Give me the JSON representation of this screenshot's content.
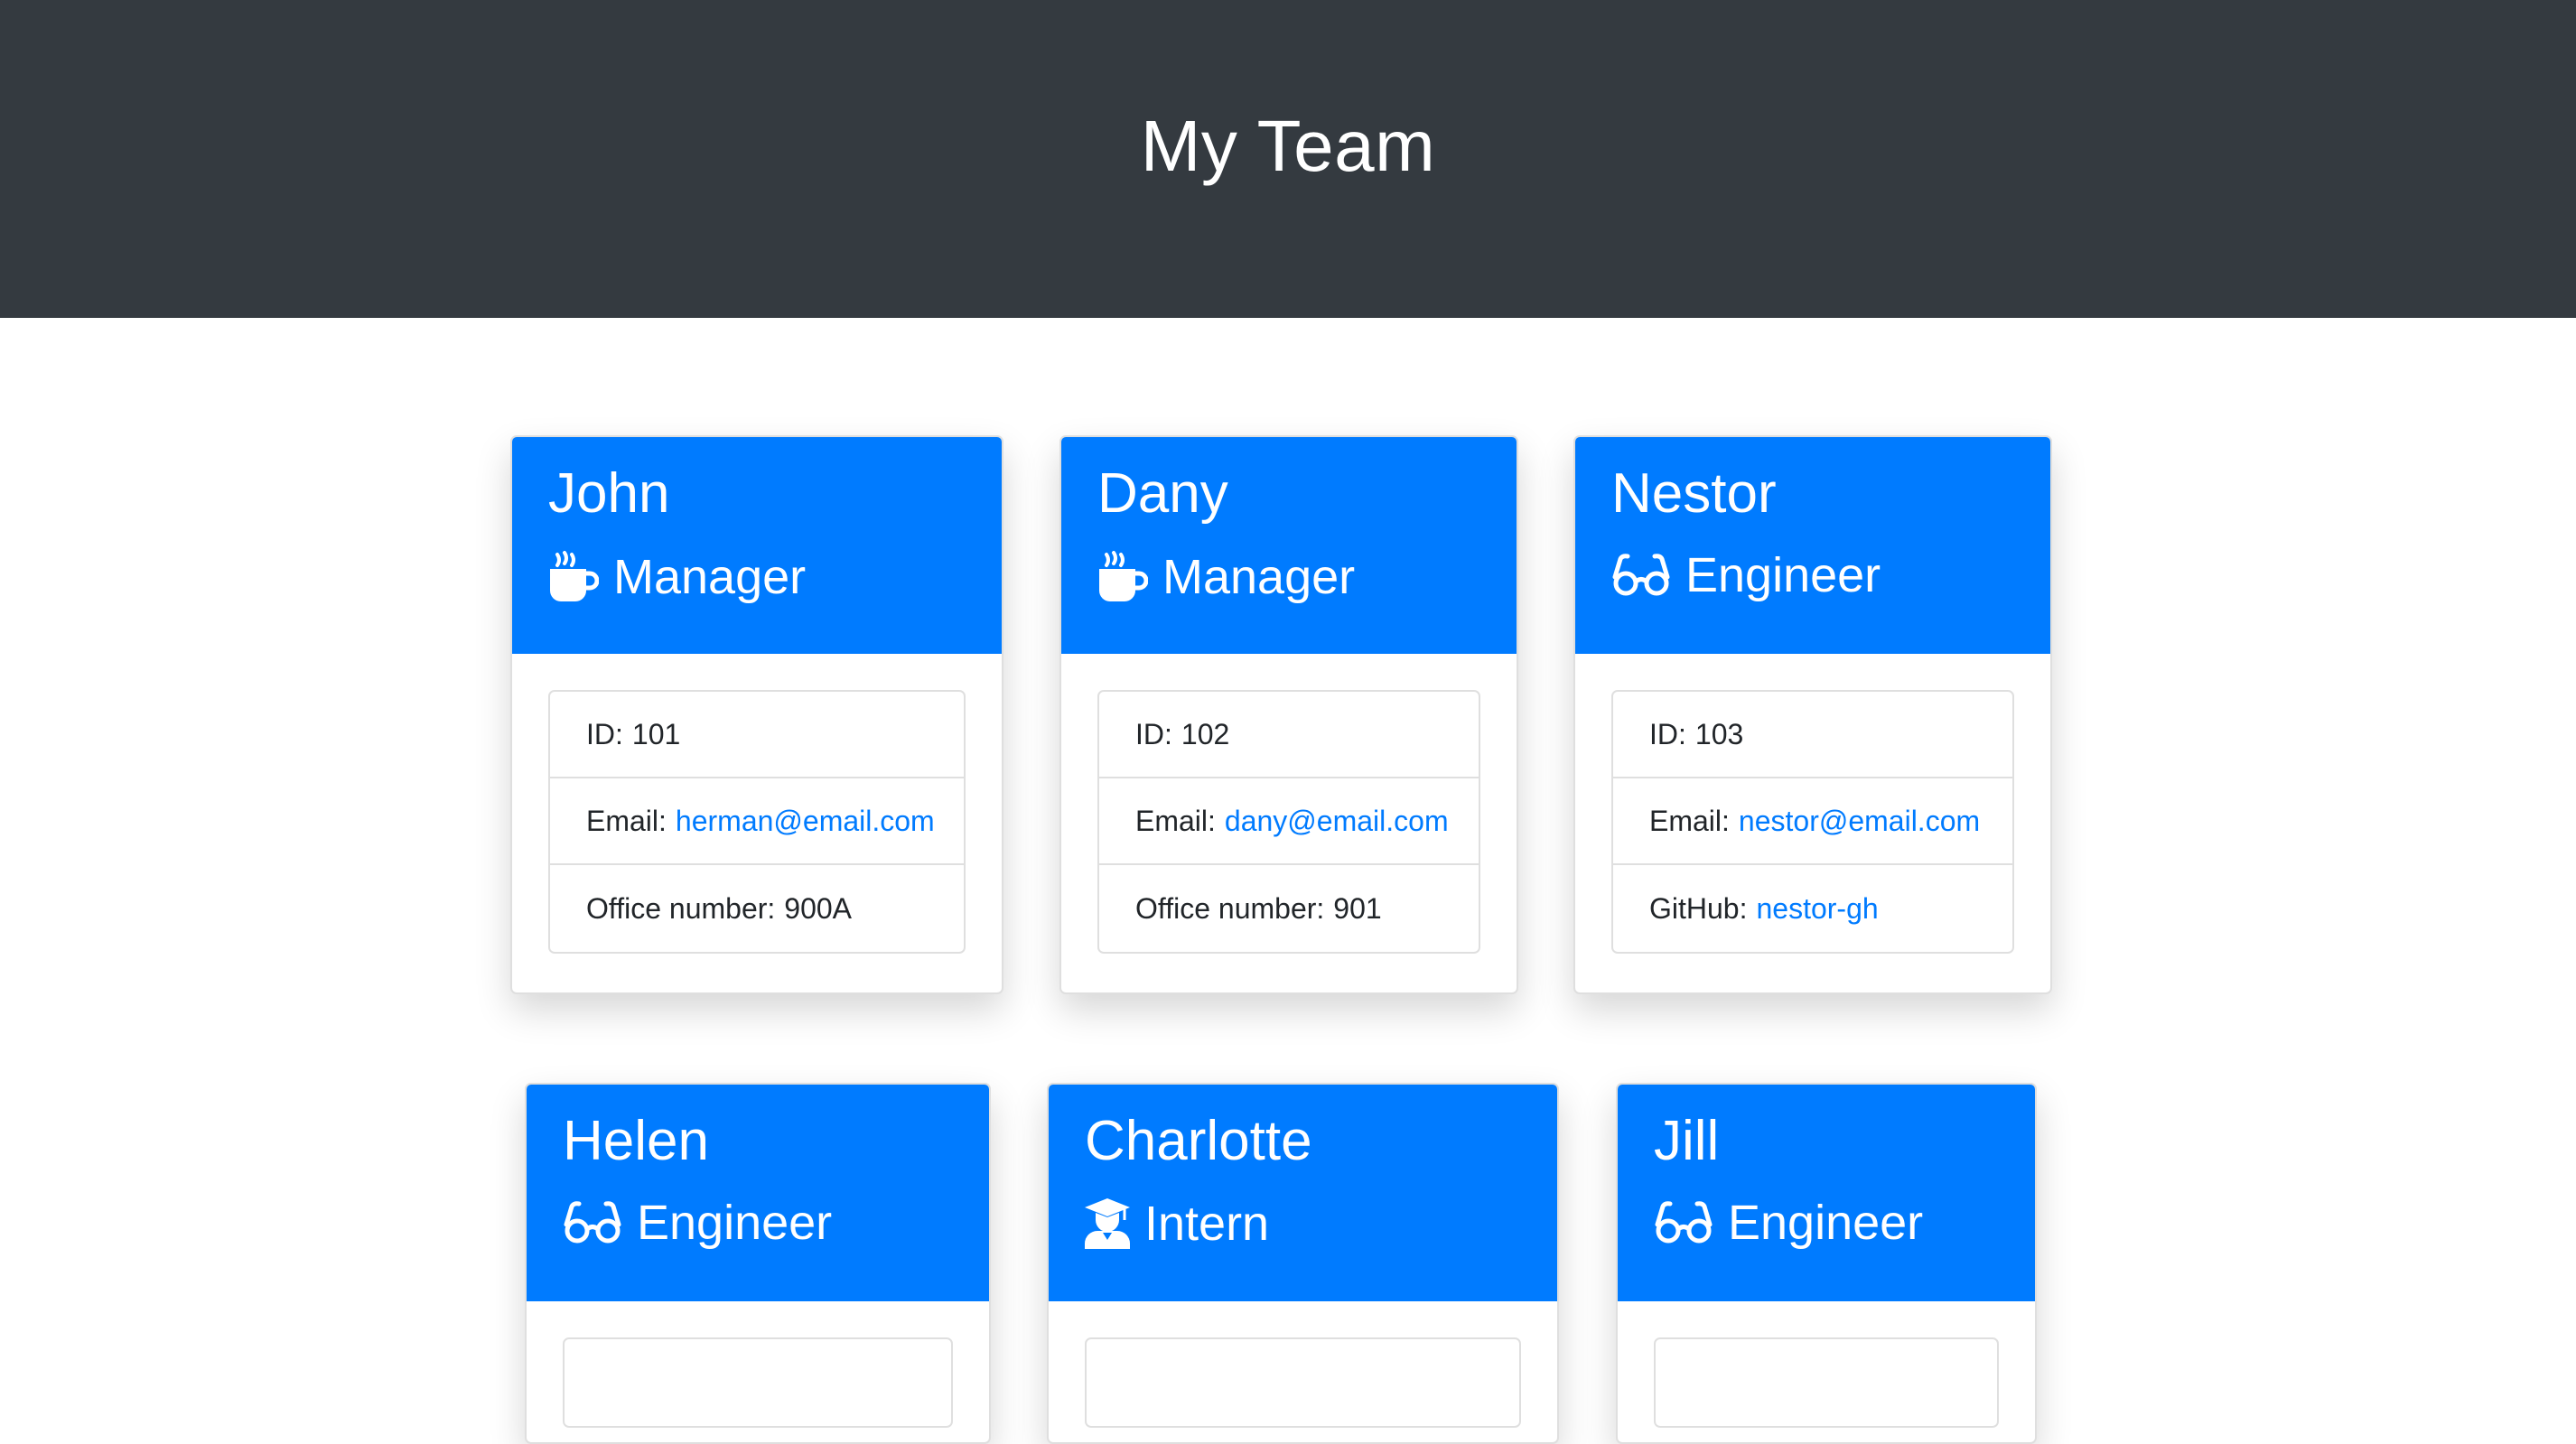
{
  "header": {
    "title": "My Team"
  },
  "employees": [
    {
      "name": "John",
      "role": "Manager",
      "icon": "mug-icon",
      "id_label": "ID:",
      "id": "101",
      "email_label": "Email:",
      "email": "herman@email.com",
      "extra_label": "Office number:",
      "extra": "900A"
    },
    {
      "name": "Dany",
      "role": "Manager",
      "icon": "mug-icon",
      "id_label": "ID:",
      "id": "102",
      "email_label": "Email:",
      "email": "dany@email.com",
      "extra_label": "Office number:",
      "extra": "901"
    },
    {
      "name": "Nestor",
      "role": "Engineer",
      "icon": "glasses-icon",
      "id_label": "ID:",
      "id": "103",
      "email_label": "Email:",
      "email": "nestor@email.com",
      "extra_label": "GitHub:",
      "extra": "nestor-gh"
    },
    {
      "name": "Helen",
      "role": "Engineer",
      "icon": "glasses-icon"
    },
    {
      "name": "Charlotte",
      "role": "Intern",
      "icon": "graduate-icon"
    },
    {
      "name": "Jill",
      "role": "Engineer",
      "icon": "glasses-icon"
    }
  ],
  "colors": {
    "header_bg": "#343a40",
    "card_header_bg": "#007bff",
    "link": "#007bff"
  }
}
